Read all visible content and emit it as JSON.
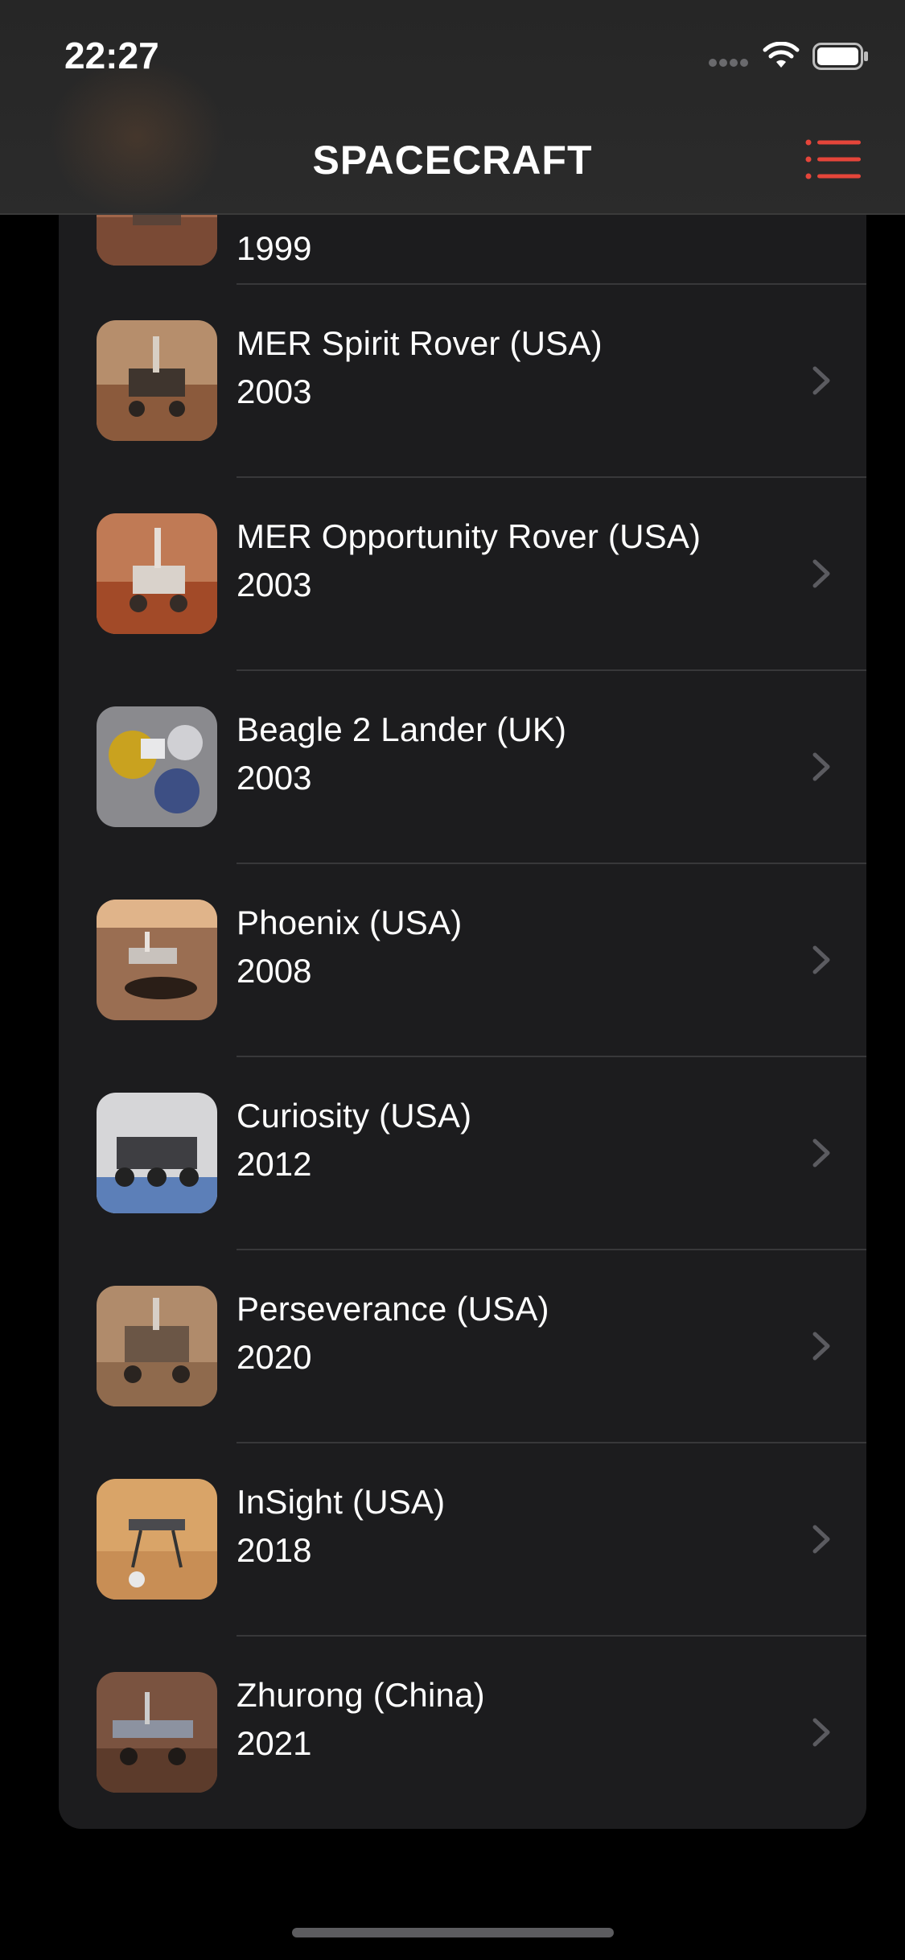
{
  "status_bar": {
    "time": "22:27"
  },
  "nav": {
    "title": "SPACECRAFT",
    "menu_icon": "list-icon"
  },
  "list": {
    "partial_year": "1999",
    "items": [
      {
        "name": "MER Spirit Rover (USA)",
        "year": "2003"
      },
      {
        "name": "MER Opportunity Rover (USA)",
        "year": "2003"
      },
      {
        "name": "Beagle 2 Lander (UK)",
        "year": "2003"
      },
      {
        "name": "Phoenix (USA)",
        "year": "2008"
      },
      {
        "name": "Curiosity (USA)",
        "year": "2012"
      },
      {
        "name": "Perseverance (USA)",
        "year": "2020"
      },
      {
        "name": "InSight (USA)",
        "year": "2018"
      },
      {
        "name": "Zhurong (China)",
        "year": "2021"
      }
    ]
  },
  "colors": {
    "accent": "#e5453a",
    "background": "#000000",
    "card": "#1c1c1e"
  }
}
